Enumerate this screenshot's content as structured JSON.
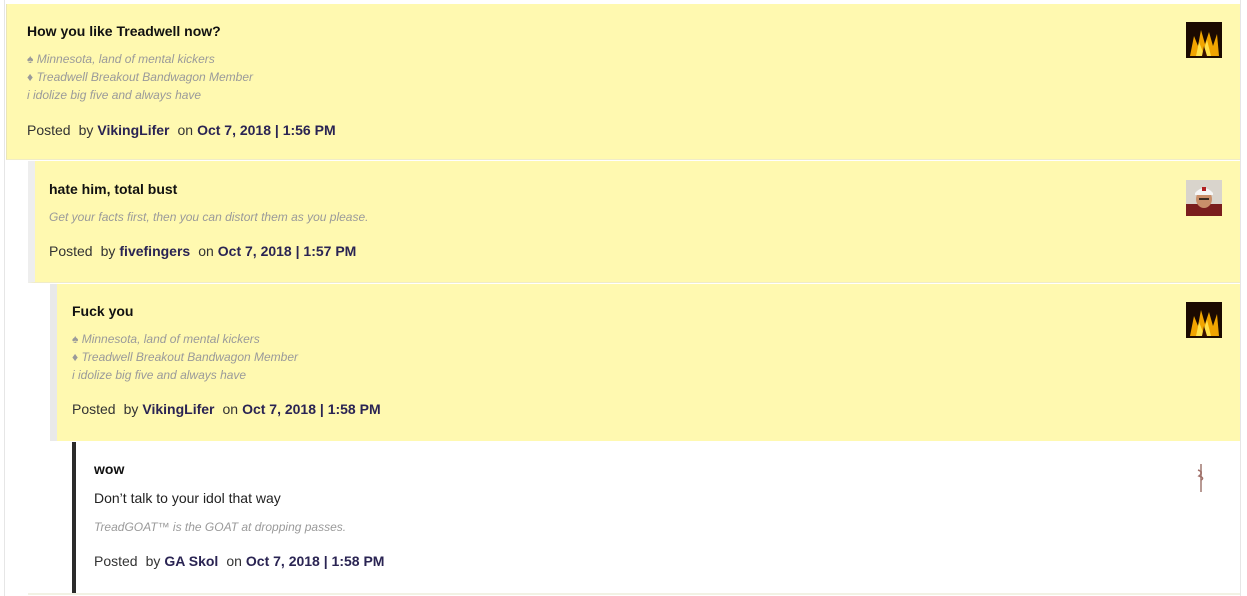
{
  "comments": [
    {
      "title": "How you like Treadwell now?",
      "signature": [
        "♠ Minnesota, land of mental kickers",
        "♦ Treadwell Breakout Bandwagon Member",
        "i idolize big five and always have"
      ],
      "posted_label": "Posted",
      "by_label": "by",
      "user": "VikingLifer",
      "on_label": "on",
      "date": "Oct 7, 2018 | 1:56 PM",
      "avatar_icon": "fire-avatar-icon"
    },
    {
      "title": "hate him, total bust",
      "signature": [
        "Get your facts first, then you can distort them as you please."
      ],
      "posted_label": "Posted",
      "by_label": "by",
      "user": "fivefingers",
      "on_label": "on",
      "date": "Oct 7, 2018 | 1:57 PM",
      "avatar_icon": "man-cap-avatar-icon"
    },
    {
      "title": "Fuck you",
      "signature": [
        "♠ Minnesota, land of mental kickers",
        "♦ Treadwell Breakout Bandwagon Member",
        "i idolize big five and always have"
      ],
      "posted_label": "Posted",
      "by_label": "by",
      "user": "VikingLifer",
      "on_label": "on",
      "date": "Oct 7, 2018 | 1:58 PM",
      "avatar_icon": "fire-avatar-icon"
    },
    {
      "title": "wow",
      "body": "Don’t talk to your idol that way",
      "signature": [
        "TreadGOAT™ is the GOAT at dropping passes."
      ],
      "posted_label": "Posted",
      "by_label": "by",
      "user": "GA Skol",
      "on_label": "on",
      "date": "Oct 7, 2018 | 1:58 PM",
      "avatar_icon": "pin-avatar-icon"
    }
  ],
  "colors": {
    "highlight": "#fff9b0",
    "link": "#2a2453",
    "signature": "#9a9a9a",
    "active_border": "#2b2b2b"
  }
}
